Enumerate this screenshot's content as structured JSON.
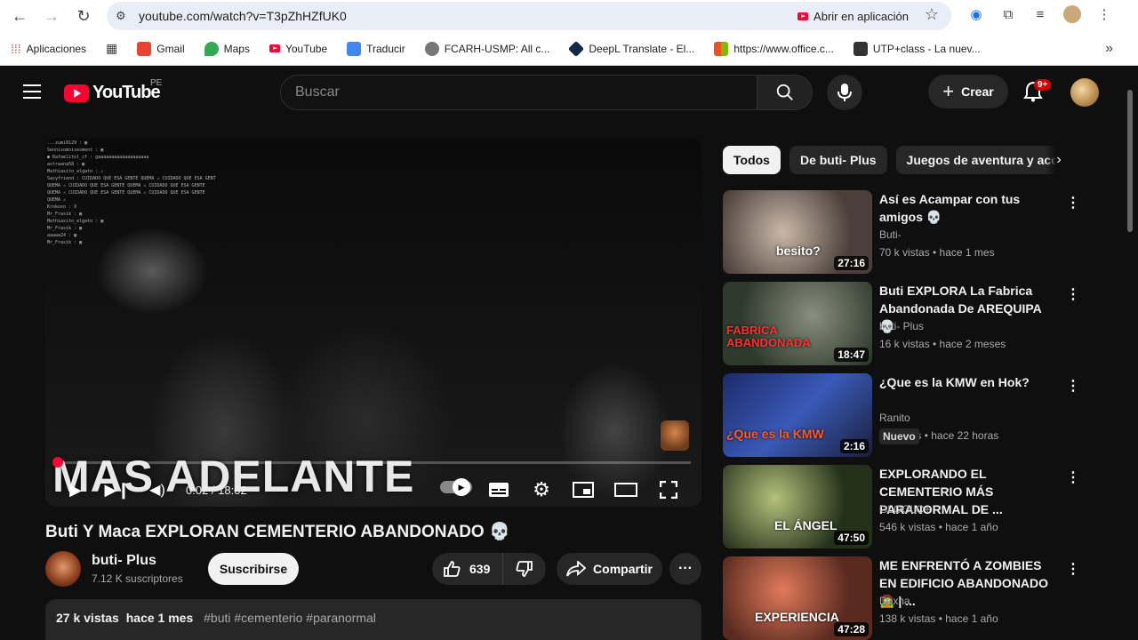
{
  "browser": {
    "url": "youtube.com/watch?v=T3pZhHZfUK0",
    "open_app_label": "Abrir en aplicación",
    "bookmarks": [
      {
        "label": "Aplicaciones",
        "icon": "apps-grid-icon",
        "color": "#e8453c"
      },
      {
        "label": "",
        "icon": "grid-icon",
        "color": "#444444"
      },
      {
        "label": "Gmail",
        "icon": "gmail-icon",
        "color": "#ea4335"
      },
      {
        "label": "Maps",
        "icon": "maps-icon",
        "color": "#34a853"
      },
      {
        "label": "YouTube",
        "icon": "youtube-icon",
        "color": "#ff0033"
      },
      {
        "label": "Traducir",
        "icon": "translate-icon",
        "color": "#4285f4"
      },
      {
        "label": "FCARH-USMP: All c...",
        "icon": "globe-icon",
        "color": "#555555"
      },
      {
        "label": "DeepL Translate - El...",
        "icon": "deepl-icon",
        "color": "#0f2b46"
      },
      {
        "label": "https://www.office.c...",
        "icon": "office-icon",
        "color": "#f25022"
      },
      {
        "label": "UTP+class - La nuev...",
        "icon": "utp-icon",
        "color": "#333333"
      }
    ]
  },
  "header": {
    "logo_text": "YouTube",
    "country_code": "PE",
    "search_placeholder": "Buscar",
    "create_label": "Crear",
    "notification_badge": "9+"
  },
  "player": {
    "caption_text": "MAS ADELANTE",
    "current_time": "0:02 / 18:02",
    "progress": 0.002,
    "chat_lines": [
      "...zumi0129 : ▦",
      "Sennisomnisesment : ▦",
      "● Rafaelitol_cf : gaaaaaaaaaaaaaaaaaaa",
      "astraana58 : ▦",
      "Mathiasito_elgato : ⚠",
      "Sasyfriend : CUIDADO QUE ESA GENTE QUEMA ⚠ CUIDADO QUE ESA GENTE",
      "QUEMA ⚠ CUIDADO QUE ESA GENTE QUEMA ⚠ CUIDADO QUE ESA GENTE",
      "QUEMA ⚠ CUIDADO QUE ESA GENTE QUEMA ⚠ CUIDADO QUE ESA GENTE",
      "QUEMA ⚠",
      "Krokoxo : X",
      "Mr_Frasik : ▦",
      "Mathiasito_elgato : ▦",
      "Mr_Frasik : ▦",
      "aaaaa24 : ▦",
      "Mr_Frasik : ▦"
    ]
  },
  "video": {
    "title": "Buti Y Maca EXPLORAN CEMENTERIO ABANDONADO 💀",
    "channel_name": "buti- Plus",
    "subscribers": "7.12 K suscriptores",
    "subscribe_label": "Suscribirse",
    "likes": "639",
    "share_label": "Compartir",
    "views": "27 k vistas",
    "age": "hace 1 mes",
    "tags": "#buti #cementerio #paranormal"
  },
  "chips": [
    "Todos",
    "De buti- Plus",
    "Juegos de aventura y acción"
  ],
  "recommendations": [
    {
      "title": "Así es Acampar con tus amigos 💀",
      "channel": "Buti-",
      "meta": "70 k vistas • hace 1 mes",
      "duration": "27:16",
      "thumb_text": "besito?",
      "thumb_color": "#6a5f5a",
      "badge": ""
    },
    {
      "title": "Buti EXPLORA La Fabrica Abandonada De AREQUIPA 💀",
      "channel": "buti- Plus",
      "meta": "16 k vistas • hace 2 meses",
      "duration": "18:47",
      "thumb_text": "FABRICA ABANDONADA",
      "thumb_color": "#3d4a3a",
      "badge": ""
    },
    {
      "title": "¿Que es la KMW en Hok?",
      "channel": "Ranito",
      "meta": "56 vistas • hace 22 horas",
      "duration": "2:16",
      "thumb_text": "¿Que es la KMW",
      "thumb_color": "#2a3f7a",
      "badge": "Nuevo"
    },
    {
      "title": "EXPLORANDO EL CEMENTERIO MÁS PARANORMAL DE ...",
      "channel": "GLOGLO+",
      "meta": "546 k vistas • hace 1 año",
      "duration": "47:50",
      "thumb_text": "EL ÁNGEL",
      "thumb_color": "#2f3a22",
      "badge": ""
    },
    {
      "title": "ME ENFRENTÓ A ZOMBIES EN EDIFICIO ABANDONADO 🧟 | ...",
      "channel": "Doxha",
      "meta": "138 k vistas • hace 1 año",
      "duration": "47:28",
      "thumb_text": "EXPERIENCIA",
      "thumb_color": "#7a3a2a",
      "badge": ""
    }
  ]
}
